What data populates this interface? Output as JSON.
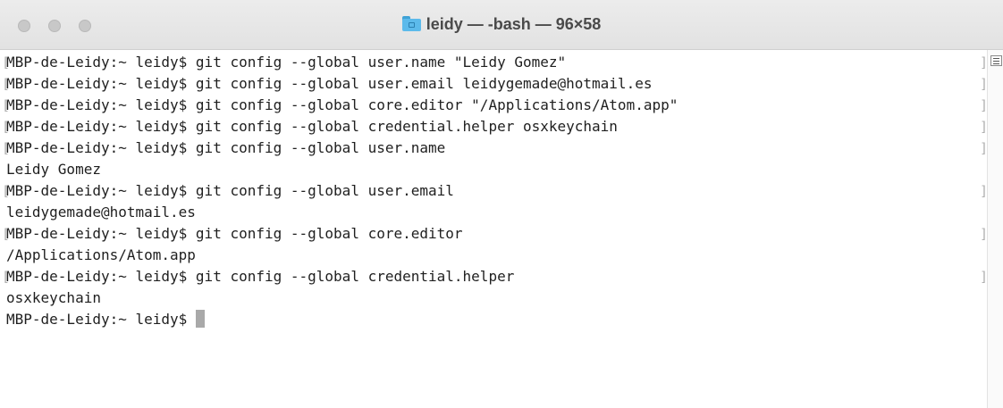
{
  "window": {
    "title": "leidy — -bash — 96×58",
    "folder_icon": "home-folder-icon"
  },
  "terminal": {
    "lines": [
      "MBP-de-Leidy:~ leidy$ git config --global user.name \"Leidy Gomez\"",
      "MBP-de-Leidy:~ leidy$ git config --global user.email leidygemade@hotmail.es",
      "MBP-de-Leidy:~ leidy$ git config --global core.editor \"/Applications/Atom.app\"",
      "MBP-de-Leidy:~ leidy$ git config --global credential.helper osxkeychain",
      "MBP-de-Leidy:~ leidy$ git config --global user.name",
      "Leidy Gomez",
      "MBP-de-Leidy:~ leidy$ git config --global user.email",
      "leidygemade@hotmail.es",
      "MBP-de-Leidy:~ leidy$ git config --global core.editor",
      "/Applications/Atom.app",
      "MBP-de-Leidy:~ leidy$ git config --global credential.helper",
      "osxkeychain",
      "MBP-de-Leidy:~ leidy$ "
    ],
    "left_mark": "[",
    "right_mark": "]"
  },
  "colors": {
    "text": "#1f1f1f",
    "cursor": "#a9a9a9",
    "folder": "#5cbaeb"
  }
}
